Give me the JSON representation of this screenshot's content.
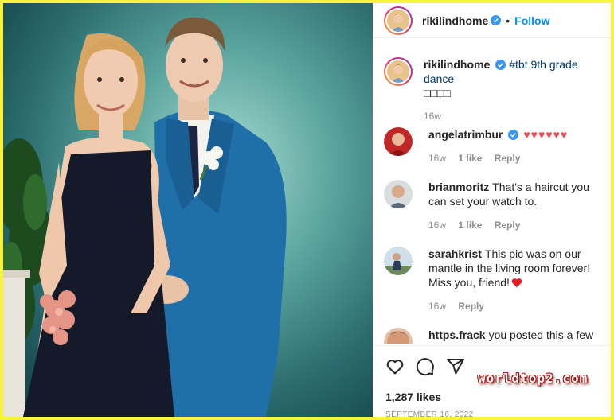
{
  "header": {
    "username": "rikilindhome",
    "separator": "•",
    "follow_label": "Follow"
  },
  "caption": {
    "username": "rikilindhome",
    "text": "#tbt 9th grade dance",
    "emoji": "□□□□",
    "time": "16w"
  },
  "comments": [
    {
      "username": "angelatrimbur",
      "verified": true,
      "text": "♥♥♥♥♥♥",
      "time": "16w",
      "likes": "1 like",
      "reply": "Reply"
    },
    {
      "username": "brianmoritz",
      "verified": false,
      "text": "That's a haircut you can set your watch to.",
      "time": "16w",
      "likes": "1 like",
      "reply": "Reply"
    },
    {
      "username": "sarahkrist",
      "verified": false,
      "text": "This pic was on our mantle in the living room forever! Miss you, friend!",
      "time": "16w",
      "likes": "",
      "reply": "Reply"
    },
    {
      "username": "https.frack",
      "verified": false,
      "text": "you posted this a few",
      "time": "",
      "likes": "",
      "reply": ""
    }
  ],
  "footer": {
    "likes": "1,287 likes",
    "date": "SEPTEMBER 16, 2022"
  },
  "watermark": "worldtop2.com",
  "icons": [
    "heart-icon",
    "comment-icon",
    "share-icon",
    "verified-icon"
  ],
  "colors": {
    "accent": "#0095f6",
    "heart": "#ed4956",
    "border": "#f7f33a",
    "meta": "#8e8e8e"
  }
}
